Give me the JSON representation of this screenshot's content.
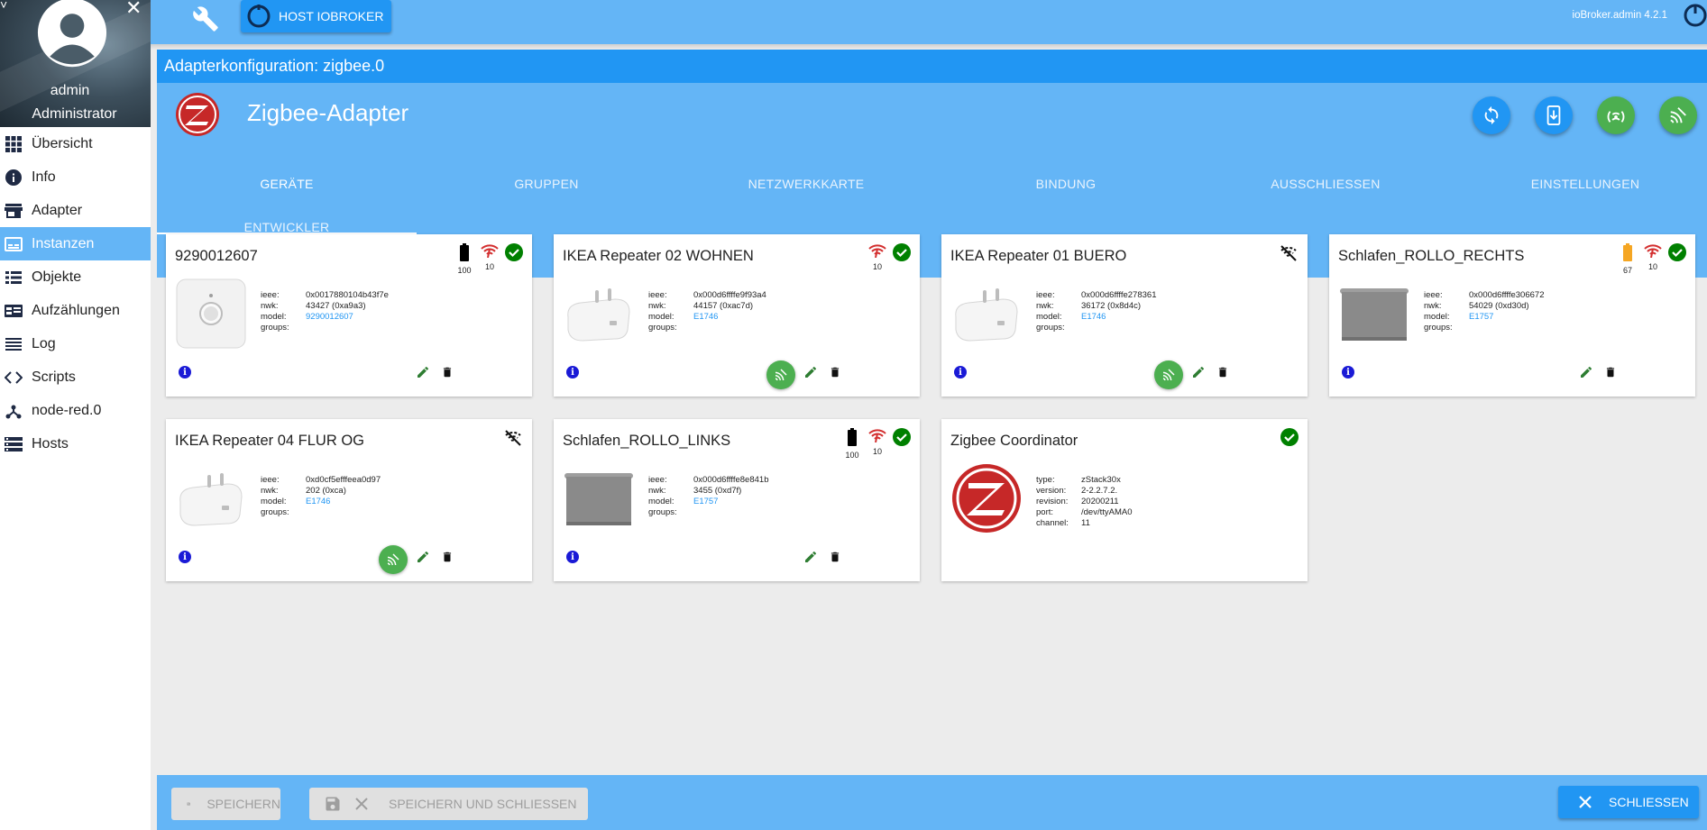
{
  "user": {
    "name": "admin",
    "role": "Administrator"
  },
  "nav": [
    {
      "label": "Übersicht",
      "icon": "apps-grid-icon"
    },
    {
      "label": "Info",
      "icon": "info-icon"
    },
    {
      "label": "Adapter",
      "icon": "store-icon"
    },
    {
      "label": "Instanzen",
      "icon": "instances-icon",
      "active": true
    },
    {
      "label": "Objekte",
      "icon": "list-icon"
    },
    {
      "label": "Aufzählungen",
      "icon": "enum-icon"
    },
    {
      "label": "Log",
      "icon": "log-lines-icon"
    },
    {
      "label": "Scripts",
      "icon": "code-icon"
    },
    {
      "label": "node-red.0",
      "icon": "node-red-icon"
    },
    {
      "label": "Hosts",
      "icon": "hosts-icon"
    }
  ],
  "topbar": {
    "host_label": "HOST IOBROKER",
    "version": "ioBroker.admin 4.2.1"
  },
  "panel": {
    "title": "Adapterkonfiguration: zigbee.0",
    "adapter_name": "Zigbee-Adapter",
    "tabs": [
      "GERÄTE",
      "GRUPPEN",
      "NETZWERKKARTE",
      "BINDUNG",
      "AUSSCHLIESSEN",
      "EINSTELLUNGEN",
      "ENTWICKLER"
    ]
  },
  "cards": [
    {
      "title": "9290012607",
      "battery": "100",
      "battery_color": "#000000",
      "signal": "10",
      "online": true,
      "image": "motion-sensor",
      "props": [
        [
          "ieee:",
          "0x0017880104b43f7e"
        ],
        [
          "nwk:",
          "43427 (0xa9a3)"
        ],
        [
          "model:",
          "9290012607"
        ],
        [
          "groups:",
          ""
        ]
      ]
    },
    {
      "title": "IKEA Repeater 02 WOHNEN",
      "signal": "10",
      "online": true,
      "image": "plug-repeater",
      "props": [
        [
          "ieee:",
          "0x000d6ffffe9f93a4"
        ],
        [
          "nwk:",
          "44157 (0xac7d)"
        ],
        [
          "model:",
          "E1746"
        ],
        [
          "groups:",
          ""
        ]
      ]
    },
    {
      "title": "IKEA Repeater 01 BUERO",
      "offline": true,
      "image": "plug-repeater",
      "props": [
        [
          "ieee:",
          "0x000d6ffffe278361"
        ],
        [
          "nwk:",
          "36172 (0x8d4c)"
        ],
        [
          "model:",
          "E1746"
        ],
        [
          "groups:",
          ""
        ]
      ]
    },
    {
      "title": "Schlafen_ROLLO_RECHTS",
      "battery": "67",
      "battery_color": "#f5a623",
      "signal": "10",
      "online": true,
      "image": "roller-blind",
      "props": [
        [
          "ieee:",
          "0x000d6ffffe306672"
        ],
        [
          "nwk:",
          "54029 (0xd30d)"
        ],
        [
          "model:",
          "E1757"
        ],
        [
          "groups:",
          ""
        ]
      ]
    },
    {
      "title": "IKEA Repeater 04 FLUR OG",
      "offline": true,
      "image": "plug-repeater",
      "props": [
        [
          "ieee:",
          "0xd0cf5efffeea0d97"
        ],
        [
          "nwk:",
          "202 (0xca)"
        ],
        [
          "model:",
          "E1746"
        ],
        [
          "groups:",
          ""
        ]
      ]
    },
    {
      "title": "Schlafen_ROLLO_LINKS",
      "battery": "100",
      "battery_color": "#000000",
      "signal": "10",
      "online": true,
      "image": "roller-blind",
      "props": [
        [
          "ieee:",
          "0x000d6ffffe8e841b"
        ],
        [
          "nwk:",
          "3455 (0xd7f)"
        ],
        [
          "model:",
          "E1757"
        ],
        [
          "groups:",
          ""
        ]
      ]
    },
    {
      "title": "Zigbee Coordinator",
      "online": true,
      "image": "zigbee-logo",
      "props": [
        [
          "type:",
          "zStack30x"
        ],
        [
          "version:",
          "2-2.2.7.2."
        ],
        [
          "revision:",
          "20200211"
        ],
        [
          "port:",
          "/dev/ttyAMA0"
        ],
        [
          "channel:",
          "11"
        ]
      ]
    }
  ],
  "footer": {
    "save": "SPEICHERN",
    "save_close": "SPEICHERN UND SCHLIESSEN",
    "close": "SCHLIESSEN"
  },
  "colors": {
    "primary": "#2196f3",
    "light": "#64b5f6",
    "green": "#4caf50",
    "ok": "#008000",
    "signal": "#d32f2f"
  }
}
